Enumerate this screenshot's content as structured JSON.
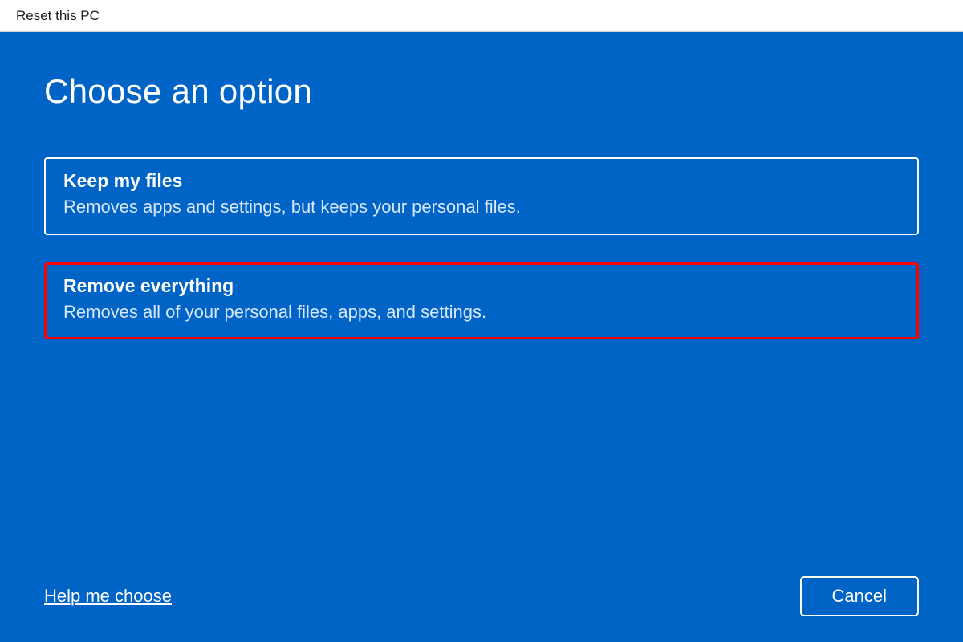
{
  "window": {
    "title": "Reset this PC"
  },
  "main": {
    "heading": "Choose an option",
    "options": [
      {
        "title": "Keep my files",
        "description": "Removes apps and settings, but keeps your personal files."
      },
      {
        "title": "Remove everything",
        "description": "Removes all of your personal files, apps, and settings."
      }
    ]
  },
  "footer": {
    "help_label": "Help me choose",
    "cancel_label": "Cancel"
  }
}
